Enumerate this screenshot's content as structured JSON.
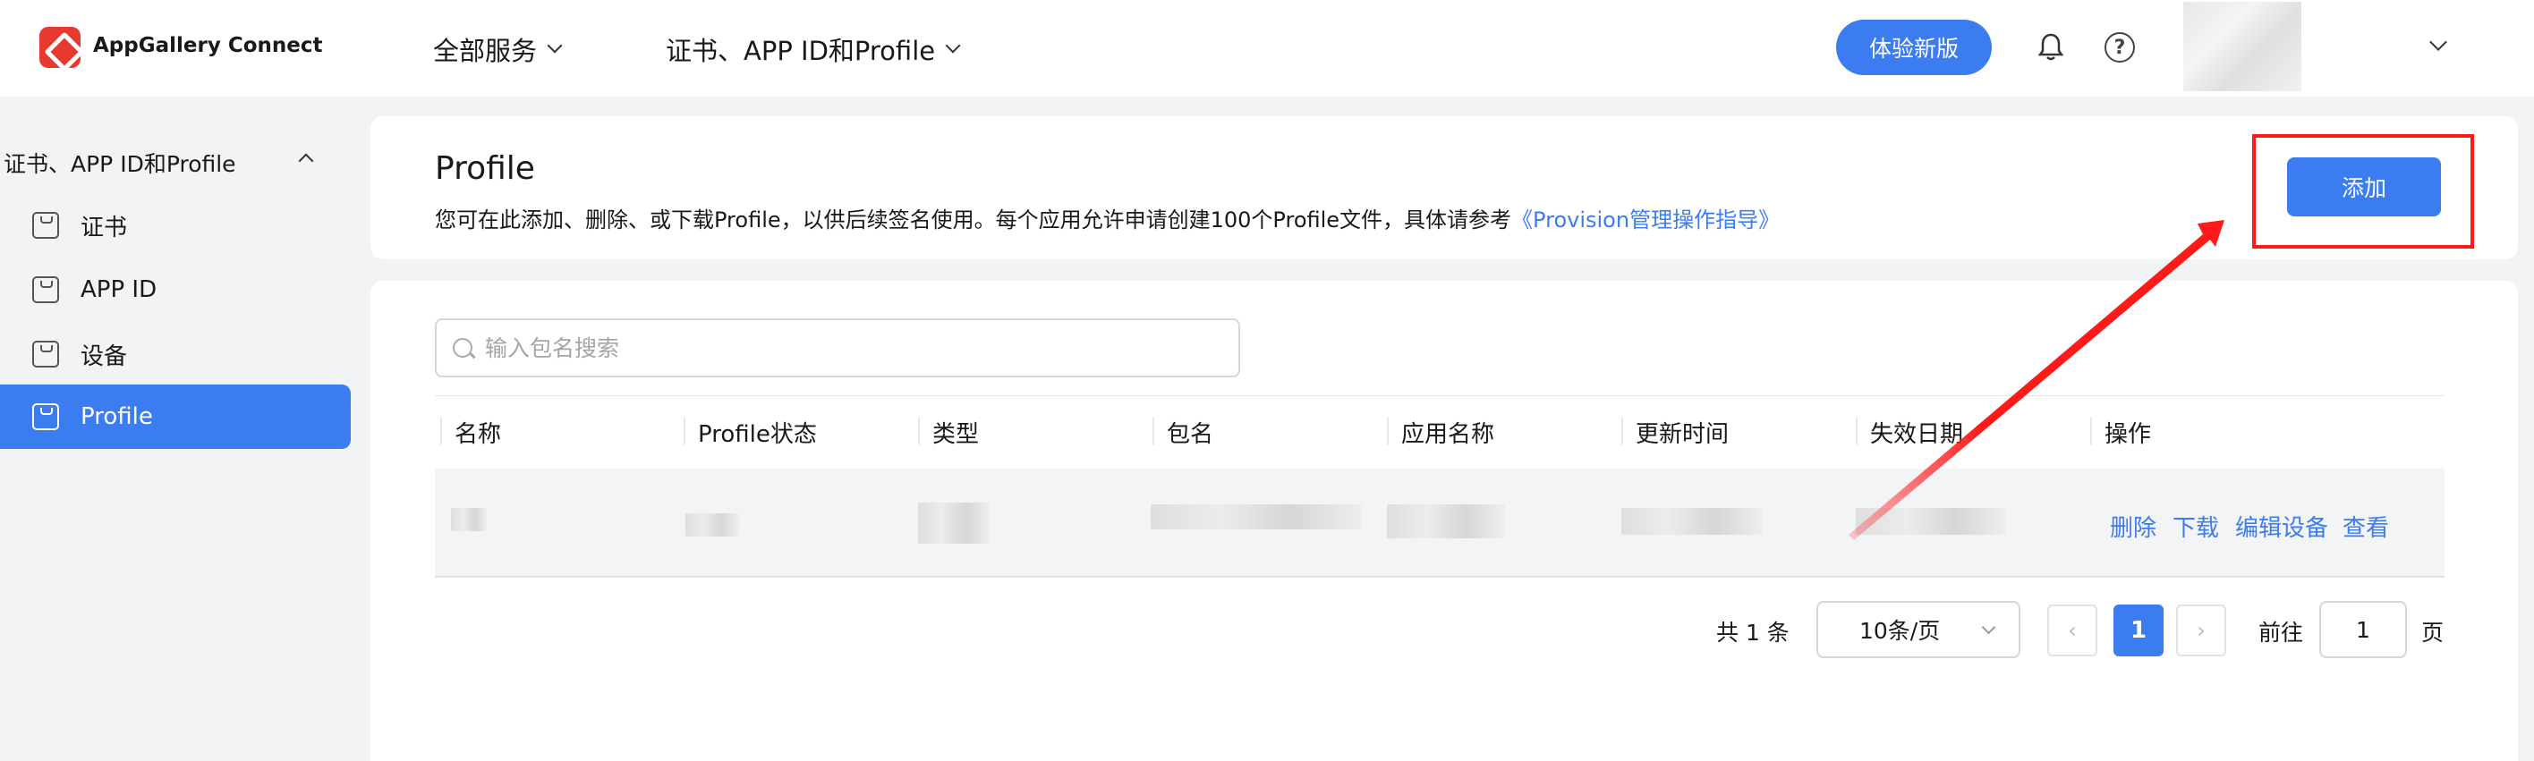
{
  "header": {
    "brand": "AppGallery Connect",
    "nav_all_services": "全部服务",
    "nav_section": "证书、APP ID和Profile",
    "trial_button": "体验新版"
  },
  "sidebar": {
    "group_label": "证书、APP ID和Profile",
    "items": [
      {
        "label": "证书"
      },
      {
        "label": "APP ID"
      },
      {
        "label": "设备"
      },
      {
        "label": "Profile"
      }
    ]
  },
  "page": {
    "title": "Profile",
    "description": "您可在此添加、删除、或下载Profile，以供后续签名使用。每个应用允许申请创建100个Profile文件，具体请参考",
    "guide_link": "《Provision管理操作指导》",
    "add_button": "添加"
  },
  "search": {
    "placeholder": "输入包名搜索"
  },
  "table": {
    "columns": [
      "名称",
      "Profile状态",
      "类型",
      "包名",
      "应用名称",
      "更新时间",
      "失效日期",
      "操作"
    ],
    "row_actions": [
      "删除",
      "下载",
      "编辑设备",
      "查看"
    ]
  },
  "pagination": {
    "total": "共 1 条",
    "page_size": "10条/页",
    "prev": "‹",
    "current": "1",
    "next": "›",
    "goto_label": "前往",
    "goto_value": "1",
    "page_label": "页"
  },
  "colors": {
    "accent": "#3b7cf0",
    "annotation": "#ff1a1a",
    "logo": "#e8392e"
  },
  "icons": {
    "logo": "appgallery-logo-icon",
    "bell": "bell-icon",
    "help": "help-icon",
    "search": "search-icon",
    "sidebar_item": "app-icon"
  }
}
